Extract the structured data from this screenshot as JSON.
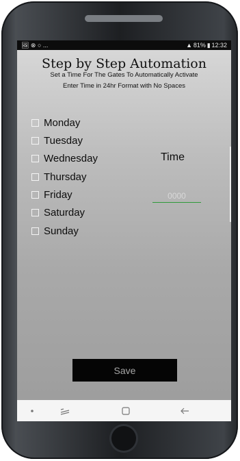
{
  "status_bar": {
    "left_icons": "🖼 ⊗ ○ ...",
    "right_text": "81%",
    "time": "12:32"
  },
  "app": {
    "title": "Step by Step Automation",
    "subtitle_1": "Set a Time For The Gates To Automatically Activate",
    "subtitle_2": "Enter Time in 24hr Format with No Spaces"
  },
  "days": [
    {
      "label": "Monday",
      "checked": false
    },
    {
      "label": "Tuesday",
      "checked": false
    },
    {
      "label": "Wednesday",
      "checked": false
    },
    {
      "label": "Thursday",
      "checked": false
    },
    {
      "label": "Friday",
      "checked": false
    },
    {
      "label": "Saturday",
      "checked": false
    },
    {
      "label": "Sunday",
      "checked": false
    }
  ],
  "time": {
    "label": "Time",
    "placeholder": "0000",
    "value": ""
  },
  "save_label": "Save",
  "colors": {
    "screen_top": "#d9d9d9",
    "screen_bottom": "#9c9c9c",
    "input_underline": "#2e9b3a",
    "save_bg": "#050505",
    "save_text": "#a6a6a6"
  },
  "nav_icons": [
    "dot-icon",
    "recent-apps-icon",
    "home-square-icon",
    "back-arrow-icon"
  ]
}
